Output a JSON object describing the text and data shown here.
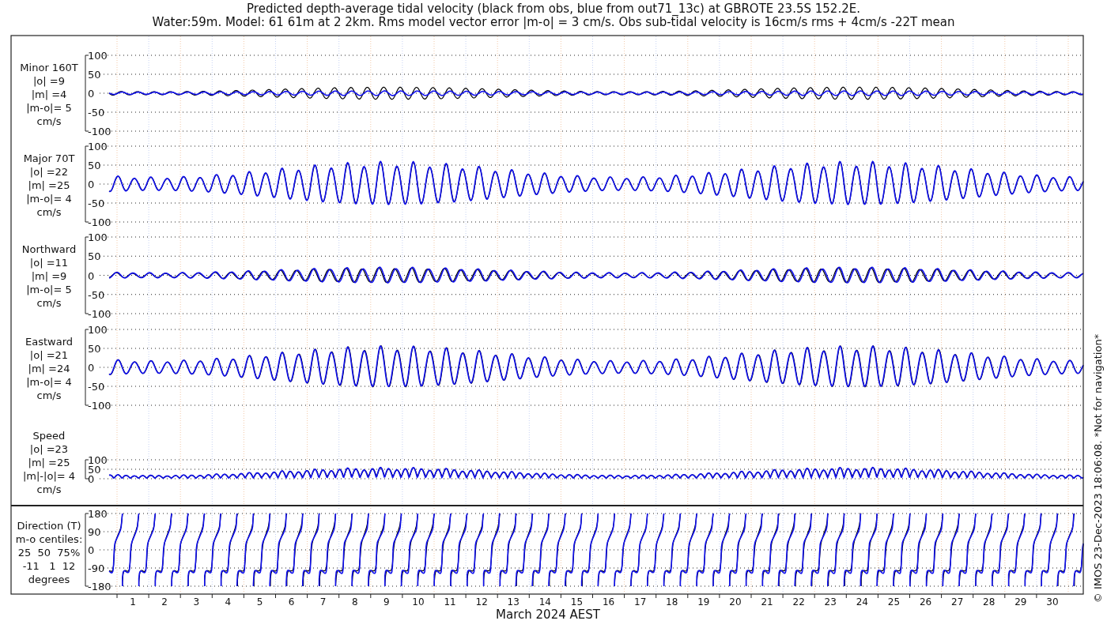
{
  "title_lines": [
    "Predicted depth-average tidal velocity (black from obs, blue from out71_13c) at GBROTE 23.5S 152.2E.",
    "Water:59m. Model: 61 61m at 2 2km. Rms model vector error |m-o| = 3 cm/s. Obs sub-tidal velocity is 16cm/s rms + 4cm/s -22T mean"
  ],
  "panels": [
    {
      "kind": "minor",
      "label_lines": [
        "Minor 160T",
        "|o| =9",
        "|m| =4",
        "|m-o|= 5",
        "cm/s"
      ],
      "yticks": [
        "100",
        "50",
        "0",
        "-50",
        "-100"
      ]
    },
    {
      "kind": "major",
      "label_lines": [
        "Major 70T",
        "|o| =22",
        "|m| =25",
        "|m-o|= 4",
        "cm/s"
      ],
      "yticks": [
        "100",
        "50",
        "0",
        "-50",
        "-100"
      ]
    },
    {
      "kind": "north",
      "label_lines": [
        "Northward",
        "|o| =11",
        "|m| =9",
        "|m-o|= 5",
        "cm/s"
      ],
      "yticks": [
        "100",
        "50",
        "0",
        "-50",
        "-100"
      ]
    },
    {
      "kind": "east",
      "label_lines": [
        "Eastward",
        "|o| =21",
        "|m| =24",
        "|m-o|= 4",
        "cm/s"
      ],
      "yticks": [
        "100",
        "50",
        "0",
        "-50",
        "-100"
      ]
    },
    {
      "kind": "speed",
      "label_lines": [
        "Speed",
        "|o| =23",
        "|m| =25",
        "|m|-|o|= 4",
        "cm/s"
      ],
      "yticks": [
        "100",
        "50",
        "0"
      ]
    },
    {
      "kind": "direction",
      "label_lines": [
        "Direction (T)",
        "m-o centiles:",
        "25  50  75%",
        "-11   1  12",
        "degrees"
      ],
      "yticks": [
        "180",
        "90",
        "0",
        "-90",
        "-180"
      ]
    }
  ],
  "x_ticks": [
    "1",
    "2",
    "3",
    "4",
    "5",
    "6",
    "7",
    "8",
    "9",
    "10",
    "11",
    "12",
    "13",
    "14",
    "15",
    "16",
    "17",
    "18",
    "19",
    "20",
    "21",
    "22",
    "23",
    "24",
    "25",
    "26",
    "27",
    "28",
    "29",
    "30"
  ],
  "xlabel": "March 2024 AEST",
  "side_note": "© IMOS 23-Dec-2023 18:06:08. *Not for navigation*"
}
